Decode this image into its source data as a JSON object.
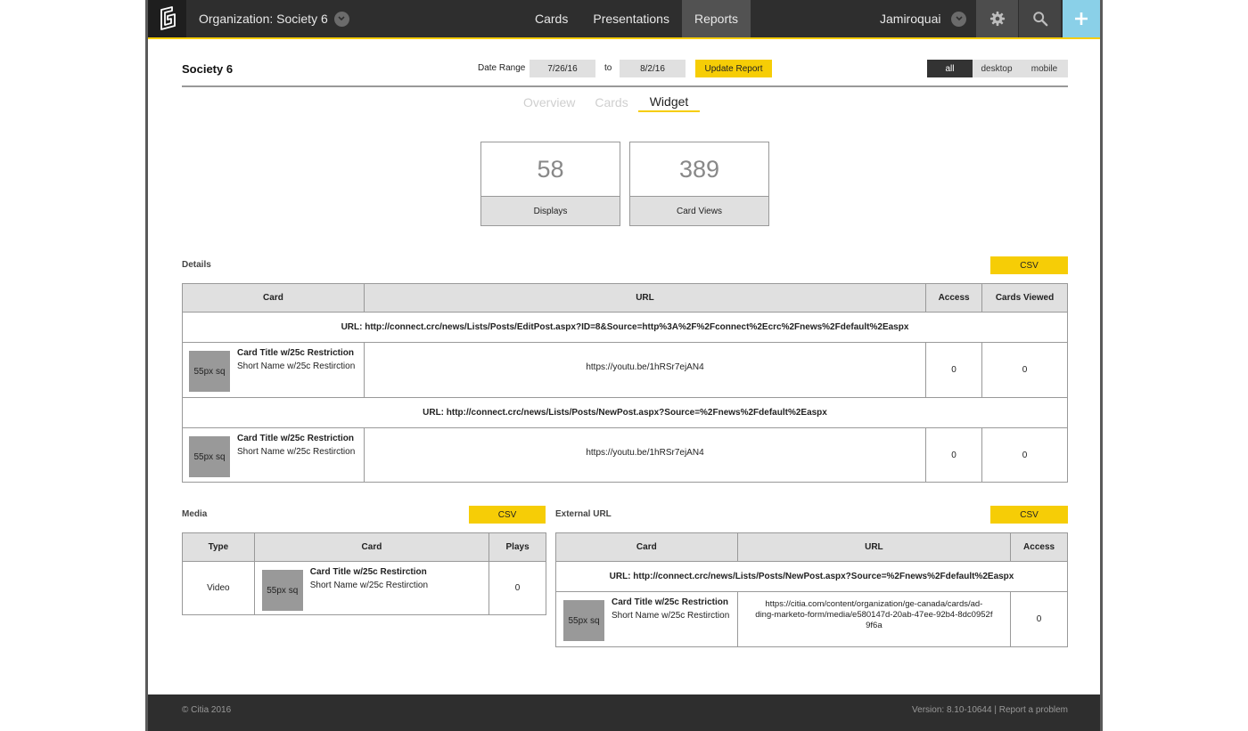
{
  "nav": {
    "org_label": "Organization: Society 6",
    "links": [
      "Cards",
      "Presentations",
      "Reports"
    ],
    "active": "Reports",
    "user": "Jamiroquai"
  },
  "header": {
    "title": "Society 6",
    "date_range_label": "Date Range",
    "from": "7/26/16",
    "to_label": "to",
    "to": "8/2/16",
    "update_label": "Update Report",
    "devices": [
      "all",
      "desktop",
      "mobile"
    ],
    "active_device": "all"
  },
  "tabs": [
    "Overview",
    "Cards",
    "Widget"
  ],
  "active_tab": "Widget",
  "stats": [
    {
      "value": "58",
      "label": "Displays"
    },
    {
      "value": "389",
      "label": "Card Views"
    }
  ],
  "details": {
    "title": "Details",
    "csv": "CSV",
    "columns": [
      "Card",
      "URL",
      "Access",
      "Cards Viewed"
    ],
    "groups": [
      {
        "url_header": "URL: http://connect.crc/news/Lists/Posts/EditPost.aspx?ID=8&Source=http%3A%2F%2Fconnect%2Ecrc%2Fnews%2Fdefault%2Easpx",
        "thumb": "55px sq",
        "card_title": "Card Title w/25c Restriction",
        "card_short": "Short Name w/25c Restirction",
        "url": "https://youtu.be/1hRSr7ejAN4",
        "access": "0",
        "viewed": "0"
      },
      {
        "url_header": "URL: http://connect.crc/news/Lists/Posts/NewPost.aspx?Source=%2Fnews%2Fdefault%2Easpx",
        "thumb": "55px sq",
        "card_title": "Card Title w/25c Restriction",
        "card_short": "Short Name w/25c Restirction",
        "url": "https://youtu.be/1hRSr7ejAN4",
        "access": "0",
        "viewed": "0"
      }
    ]
  },
  "media": {
    "title": "Media",
    "csv": "CSV",
    "columns": [
      "Type",
      "Card",
      "Plays"
    ],
    "row": {
      "type": "Video",
      "thumb": "55px sq",
      "card_title": "Card Title w/25c Restirction",
      "card_short": "Short Name w/25c Restirction",
      "plays": "0"
    }
  },
  "external": {
    "title": "External URL",
    "csv": "CSV",
    "columns": [
      "Card",
      "URL",
      "Access"
    ],
    "url_header": "URL: http://connect.crc/news/Lists/Posts/NewPost.aspx?Source=%2Fnews%2Fdefault%2Easpx",
    "row": {
      "thumb": "55px sq",
      "card_title": "Card Title w/25c Restriction",
      "card_short": "Short Name w/25c Restirction",
      "url_line1": "https://citia.com/content/organization/ge-canada/cards/ad-",
      "url_line2": "ding-marketo-form/media/e580147d-20ab-47ee-92b4-8dc0952f",
      "url_line3": "9f6a",
      "access": "0"
    }
  },
  "footer": {
    "copyright": "© Citia 2016",
    "version": "Version: 8.10-10644",
    "separator": "|",
    "report": "Report a problem"
  },
  "colors": {
    "accent": "#f6cd06",
    "nav_bg": "#2e2e2e",
    "plus_bg": "#8ad0e8"
  }
}
